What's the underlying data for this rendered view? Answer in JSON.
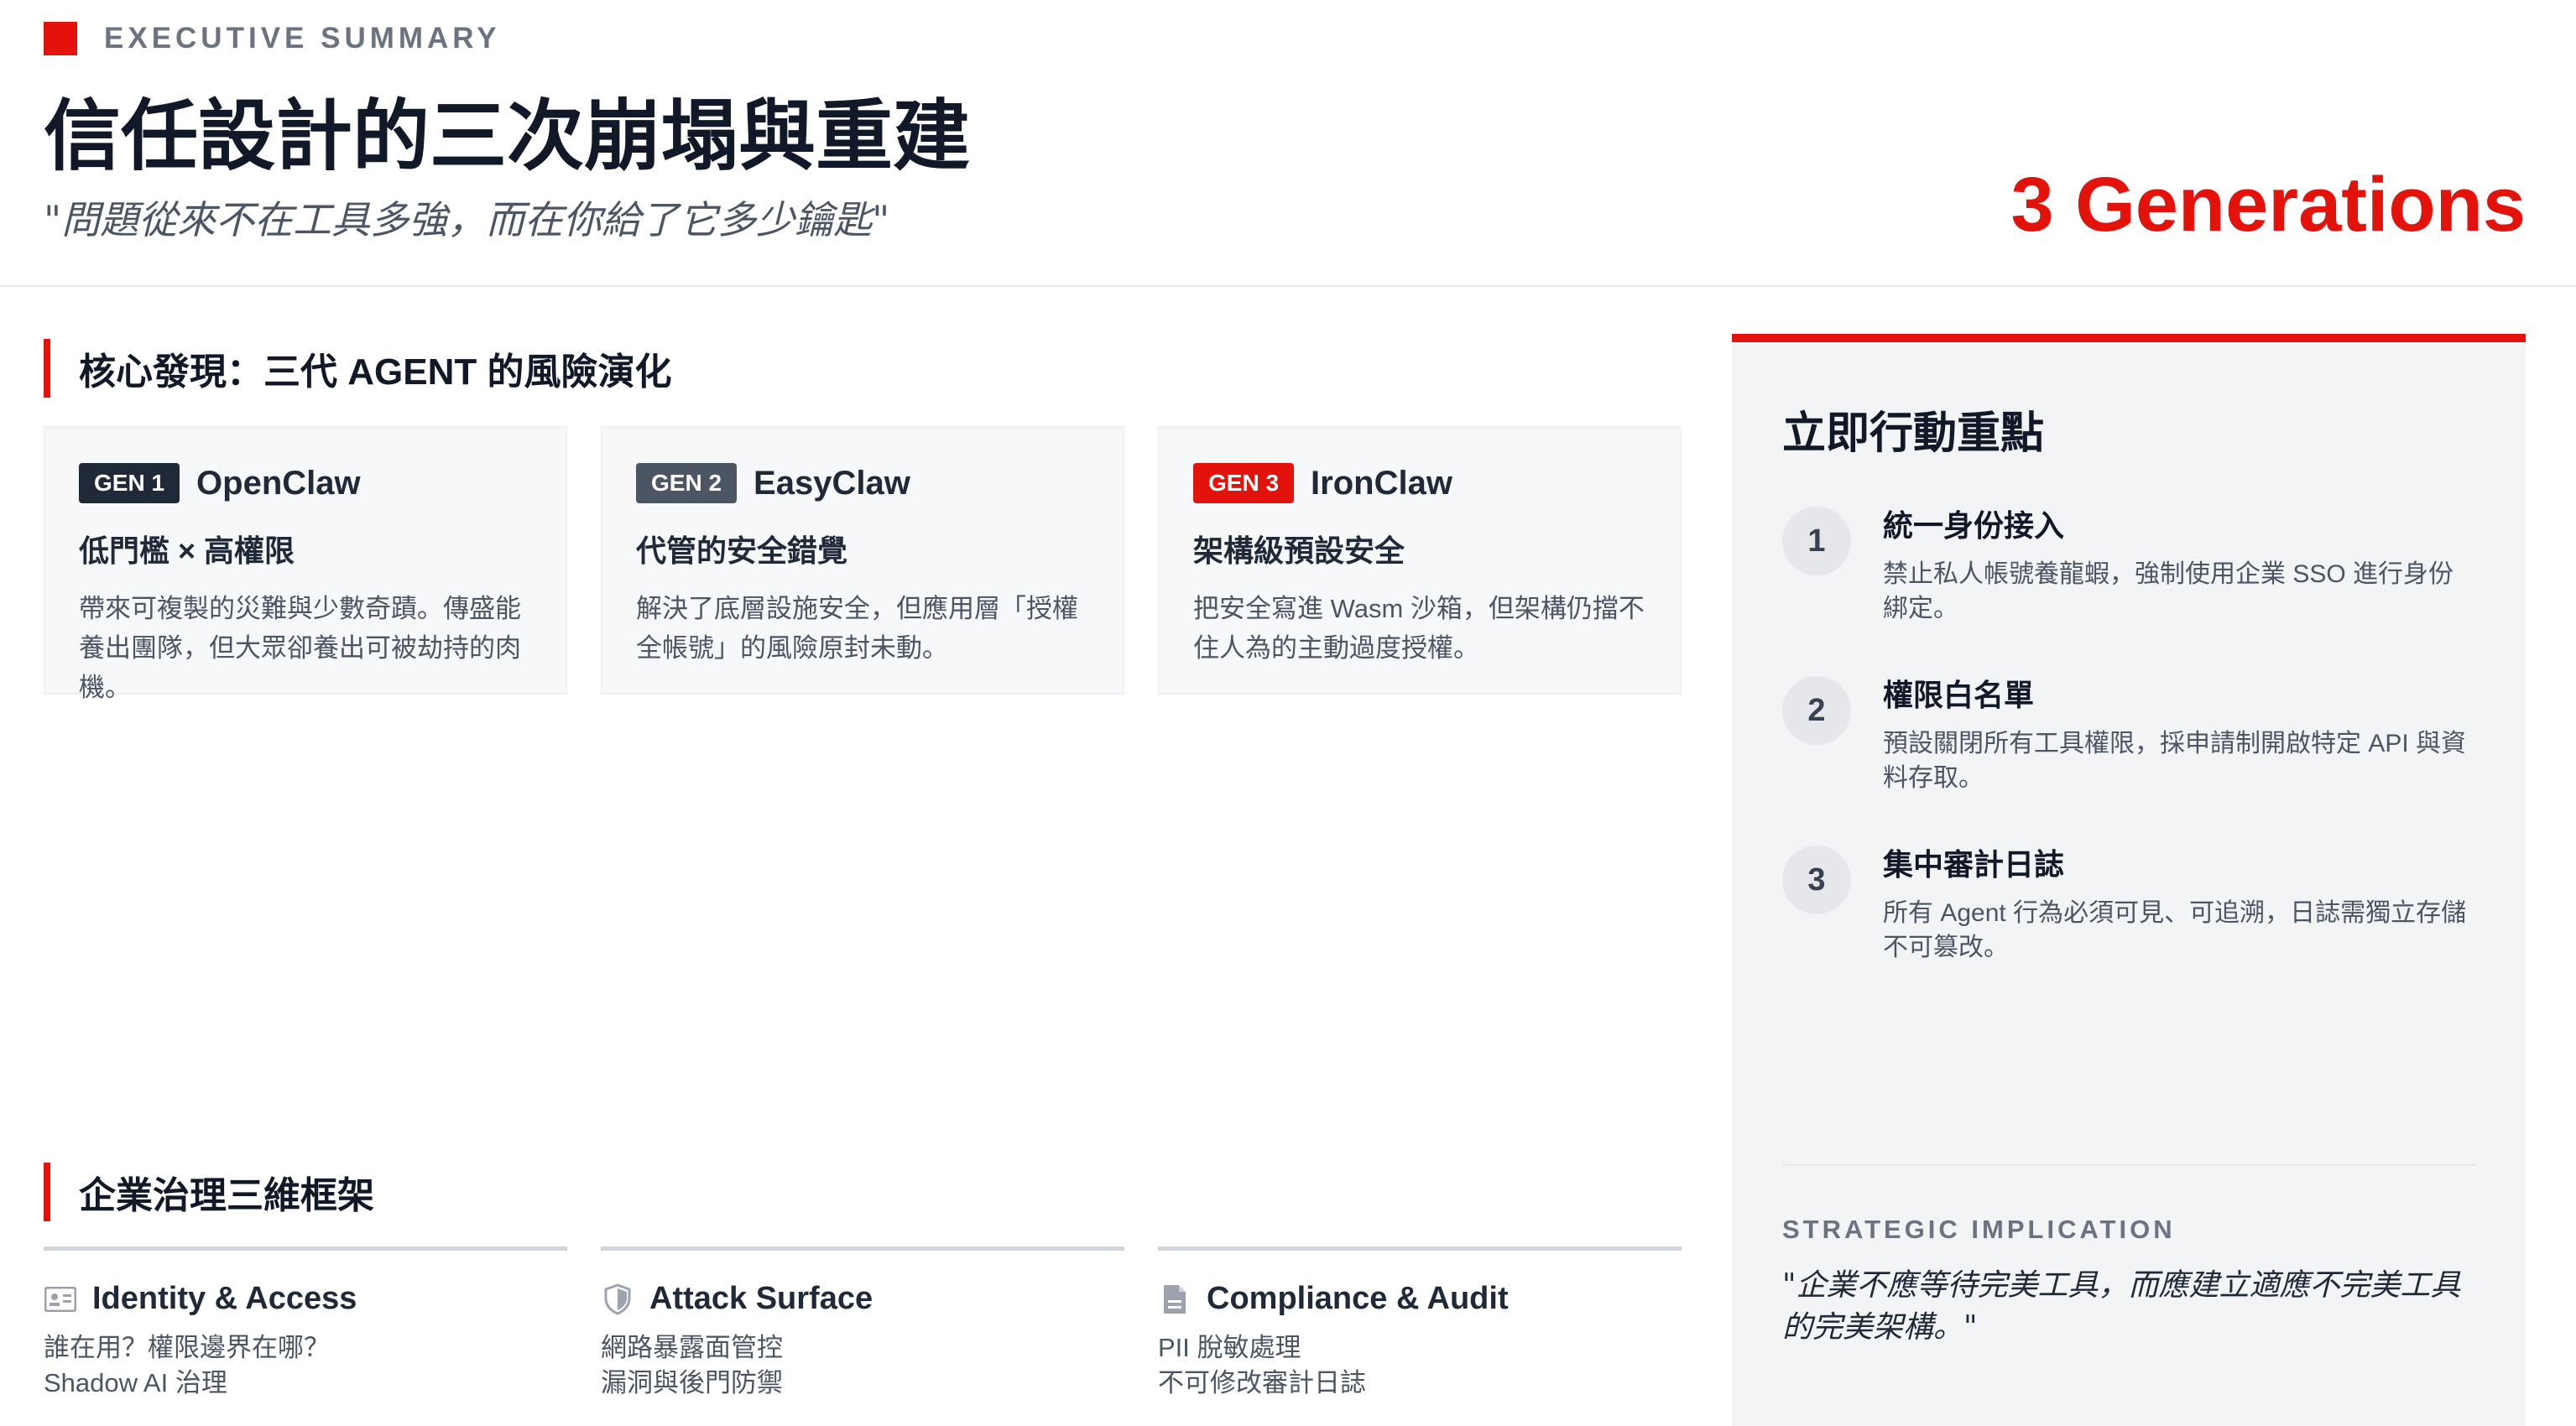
{
  "header": {
    "eyebrow": "EXECUTIVE SUMMARY",
    "title": "信任設計的三次崩塌與重建",
    "quote": "\"問題從來不在工具多強，而在你給了它多少鑰匙\"",
    "highlight": "3 Generations"
  },
  "colors": {
    "accent": "#e3120b",
    "dark_badge": "#1f2937",
    "mid_badge": "#4b5563"
  },
  "findings": {
    "heading": "核心發現：三代 AGENT 的風險演化",
    "cards": [
      {
        "badge": "GEN 1",
        "name": "OpenClaw",
        "subtitle": "低門檻 × 高權限",
        "desc": "帶來可複製的災難與少數奇蹟。傳盛能養出團隊，但大眾卻養出可被劫持的肉機。"
      },
      {
        "badge": "GEN 2",
        "name": "EasyClaw",
        "subtitle": "代管的安全錯覺",
        "desc": "解決了底層設施安全，但應用層「授權全帳號」的風險原封未動。"
      },
      {
        "badge": "GEN 3",
        "name": "IronClaw",
        "subtitle": "架構級預設安全",
        "desc": "把安全寫進 Wasm 沙箱，但架構仍擋不住人為的主動過度授權。"
      }
    ]
  },
  "framework": {
    "heading": "企業治理三維框架",
    "columns": [
      {
        "icon": "id-card-icon",
        "title": "Identity & Access",
        "lines": [
          "誰在用？權限邊界在哪？",
          "Shadow AI 治理"
        ]
      },
      {
        "icon": "shield-icon",
        "title": "Attack Surface",
        "lines": [
          "網路暴露面管控",
          "漏洞與後門防禦"
        ]
      },
      {
        "icon": "document-icon",
        "title": "Compliance & Audit",
        "lines": [
          "PII 脫敏處理",
          "不可修改審計日誌"
        ]
      }
    ]
  },
  "sidebar": {
    "title": "立即行動重點",
    "actions": [
      {
        "num": "1",
        "title": "統一身份接入",
        "text": "禁止私人帳號養龍蝦，強制使用企業 SSO 進行身份綁定。"
      },
      {
        "num": "2",
        "title": "權限白名單",
        "text": "預設關閉所有工具權限，採申請制開啟特定 API 與資料存取。"
      },
      {
        "num": "3",
        "title": "集中審計日誌",
        "text": "所有 Agent 行為必須可見、可追溯，日誌需獨立存儲不可篡改。"
      }
    ],
    "implication_label": "STRATEGIC IMPLICATION",
    "implication_quote": "\"企業不應等待完美工具，而應建立適應不完美工具的完美架構。\""
  }
}
